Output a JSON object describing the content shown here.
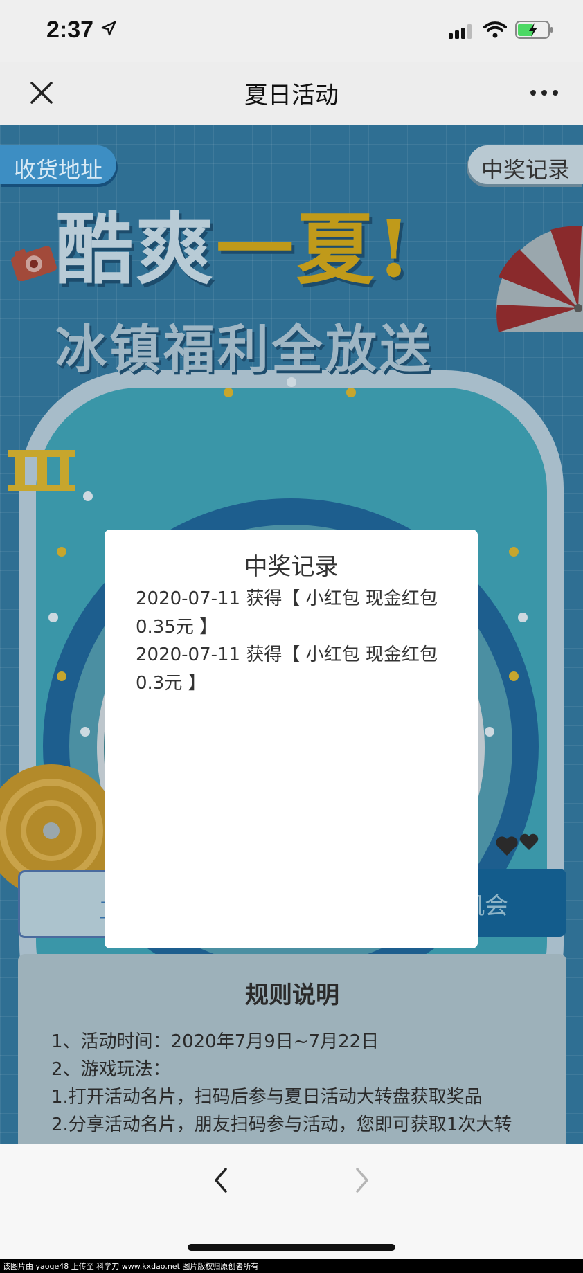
{
  "status_bar": {
    "time": "2:37",
    "icons": [
      "location-arrow-icon",
      "signal-icon",
      "wifi-icon",
      "battery-charging-icon"
    ]
  },
  "nav": {
    "title": "夏日活动",
    "close_icon": "close-icon",
    "more_icon": "more-icon"
  },
  "page": {
    "address_button": "收货地址",
    "records_button": "中奖记录",
    "headline_line1_a": "酷爽",
    "headline_line1_b": "一夏!",
    "headline_line2": "冰镇福利全放送",
    "start_button": "立即开始",
    "chance_button": "获得抽奖机会",
    "rules": {
      "title": "规则说明",
      "lines": [
        "1、活动时间：2020年7月9日~7月22日",
        "2、游戏玩法：",
        "1.打开活动名片，扫码后参与夏日活动大转盘获取奖品",
        "2.分享活动名片，朋友扫码参与活动，您即可获取1次大转"
      ]
    }
  },
  "modal": {
    "title": "中奖记录",
    "records": [
      "2020-07-11  获得【 小红包 现金红包 0.35元 】",
      "2020-07-11  获得【 小红包 现金红包 0.3元 】"
    ],
    "close_icon": "close-circle-icon"
  },
  "bottom_nav": {
    "back_icon": "chevron-left-icon",
    "forward_icon": "chevron-right-icon"
  },
  "watermark": "该图片由 yaoge48 上传至 科学刀 www.kxdao.net 图片版权归原创者所有",
  "colors": {
    "page_bg": "#2f6f93",
    "accent_blue": "#135c8c",
    "gold": "#c09a1a",
    "modal_bg": "#ffffff"
  }
}
